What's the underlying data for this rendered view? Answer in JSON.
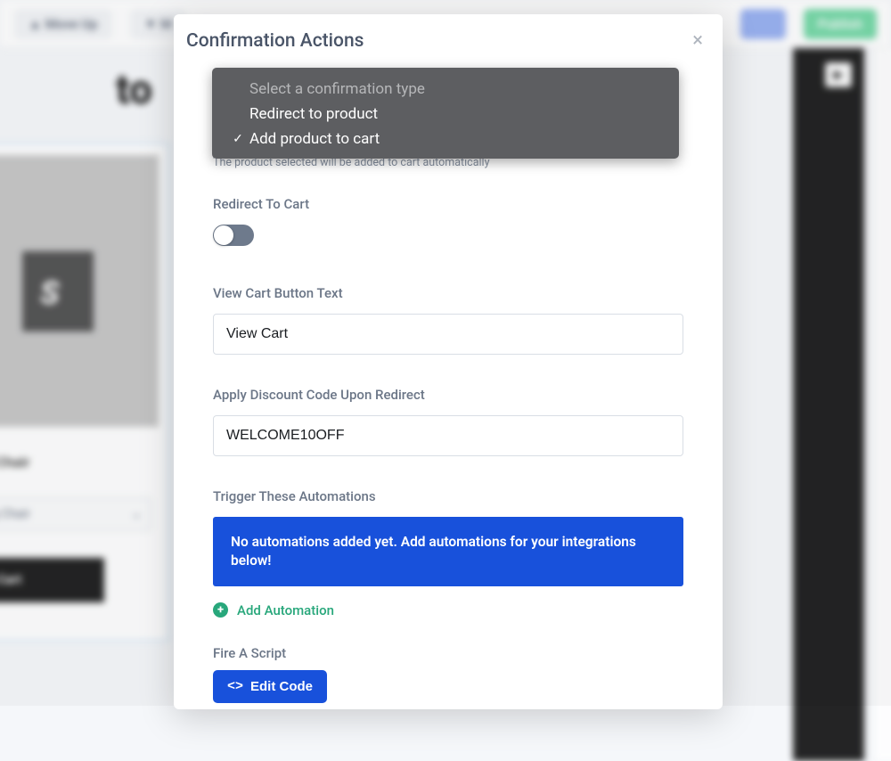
{
  "bg": {
    "moveUp": "Move Up",
    "moveDown": "M",
    "publish": "Publish",
    "heading": "to",
    "productTitle": "ning Chair",
    "variantLabel": "ning Chair",
    "addToCart": "Add To Cart"
  },
  "modal": {
    "title": "Confirmation Actions",
    "dropdown": {
      "placeholder": "Select a confirmation type",
      "options": [
        {
          "label": "Redirect to product",
          "selected": false
        },
        {
          "label": "Add product to cart",
          "selected": true
        }
      ]
    },
    "helperText": "The product selected will be added to cart automatically",
    "redirectLabel": "Redirect To Cart",
    "viewCartLabel": "View Cart Button Text",
    "viewCartValue": "View Cart",
    "discountLabel": "Apply Discount Code Upon Redirect",
    "discountValue": "WELCOME10OFF",
    "automationsLabel": "Trigger These Automations",
    "automationsAlert": "No automations added yet. Add automations for your integrations below!",
    "addAutomation": "Add Automation",
    "fireScriptLabel": "Fire A Script",
    "editCode": "Edit Code"
  }
}
